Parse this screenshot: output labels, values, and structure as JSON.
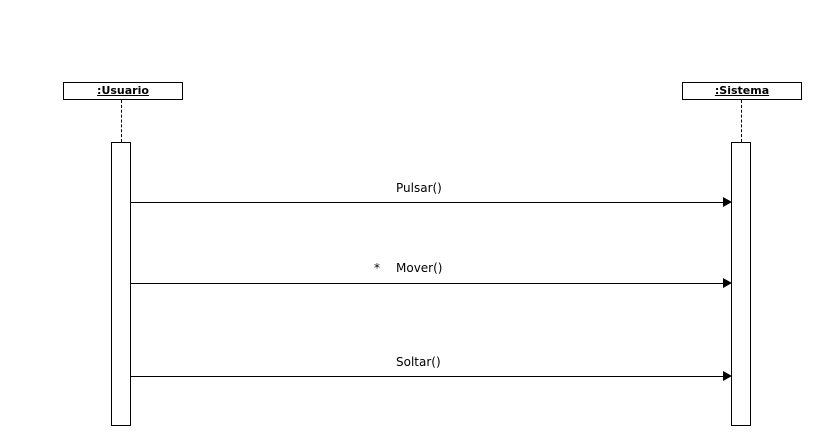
{
  "participants": [
    {
      "label": ":Usuario"
    },
    {
      "label": ":Sistema"
    }
  ],
  "messages": [
    {
      "label": "Pulsar()",
      "from": ":Usuario",
      "to": ":Sistema",
      "iteration_marker": ""
    },
    {
      "label": "Mover()",
      "from": ":Usuario",
      "to": ":Sistema",
      "iteration_marker": "*"
    },
    {
      "label": "Soltar()",
      "from": ":Usuario",
      "to": ":Sistema",
      "iteration_marker": ""
    }
  ],
  "colors": {
    "line": "#000000",
    "background": "#ffffff"
  }
}
